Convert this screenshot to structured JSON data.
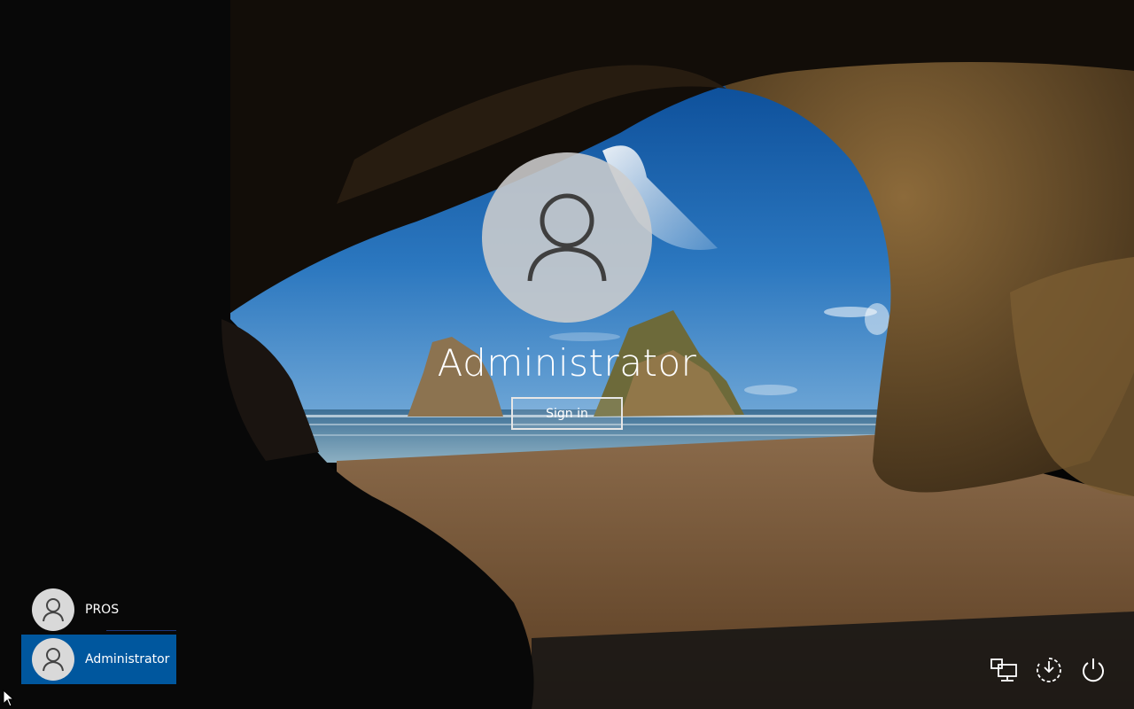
{
  "lock_screen": {
    "user_name": "Administrator",
    "signin_label": "Sign in"
  },
  "user_list": {
    "items": [
      {
        "label": "PROS",
        "selected": false
      },
      {
        "label": "Administrator",
        "selected": true
      }
    ]
  },
  "system_icons": {
    "network": "network-icon",
    "ease_of_access": "ease-of-access-icon",
    "power": "power-icon"
  },
  "colors": {
    "selected_user_bg": "#00579e",
    "avatar_bg": "#cdcdcd"
  }
}
